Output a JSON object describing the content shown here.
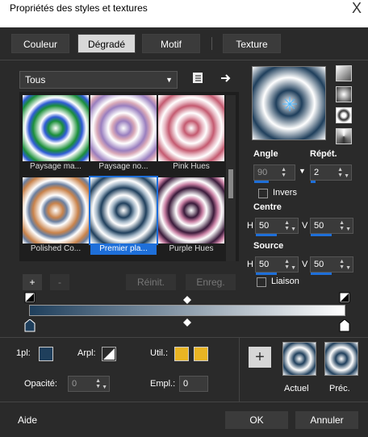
{
  "window": {
    "title": "Propriétés des styles et textures",
    "close_glyph": "X"
  },
  "tabs": [
    {
      "label": "Couleur",
      "active": false
    },
    {
      "label": "Dégradé",
      "active": true
    },
    {
      "label": "Motif",
      "active": false
    },
    {
      "label": "Texture",
      "active": false
    }
  ],
  "category": {
    "selected": "Tous"
  },
  "presets": [
    {
      "label": "Paysage ma...",
      "colors": [
        "#ffffff",
        "#1a8f3a",
        "#2f5bd6"
      ]
    },
    {
      "label": "Paysage no...",
      "colors": [
        "#ffffff",
        "#9a7fbf",
        "#d9a9b8"
      ]
    },
    {
      "label": "Pink Hues",
      "colors": [
        "#ffffff",
        "#c45a70",
        "#e8b7c2"
      ]
    },
    {
      "label": "Polished Co...",
      "colors": [
        "#ffffff",
        "#c8824a",
        "#6a7fa0"
      ]
    },
    {
      "label": "Premier pla...",
      "colors": [
        "#ffffff",
        "#1f3f5c",
        "#9fb3c4"
      ],
      "selected": true
    },
    {
      "label": "Purple Hues",
      "colors": [
        "#ffffff",
        "#3a1a3a",
        "#c87fa3"
      ]
    }
  ],
  "preset_buttons": {
    "add": "+",
    "remove": "-",
    "reset": "Réinit.",
    "save": "Enreg."
  },
  "angle": {
    "label": "Angle",
    "value": "90"
  },
  "repeat": {
    "label": "Répét.",
    "value": "2"
  },
  "invert": {
    "label": "Invers",
    "checked": false
  },
  "center": {
    "label": "Centre",
    "h_label": "H",
    "h": "50",
    "v_label": "V",
    "v": "50"
  },
  "source": {
    "label": "Source",
    "h_label": "H",
    "h": "50",
    "v_label": "V",
    "v": "50"
  },
  "link": {
    "label": "Liaison",
    "checked": false
  },
  "gradient": {
    "start": "#1f3f5c",
    "end": "#ffffff"
  },
  "stop_color": {
    "label": "1pl:",
    "value": "#1f3f5c"
  },
  "stop_position": {
    "label": "Arpl:"
  },
  "use_colors": {
    "label": "Util.:",
    "colors": [
      "#e9b423",
      "#e9b423"
    ]
  },
  "opacity": {
    "label": "Opacité:",
    "value": "0"
  },
  "location": {
    "label": "Empl.:",
    "value": "0"
  },
  "current": {
    "label": "Actuel"
  },
  "previous": {
    "label": "Préc."
  },
  "footer": {
    "help": "Aide",
    "ok": "OK",
    "cancel": "Annuler"
  },
  "colors": {
    "accent": "#1e6fd9",
    "background": "#2a2a2a"
  }
}
